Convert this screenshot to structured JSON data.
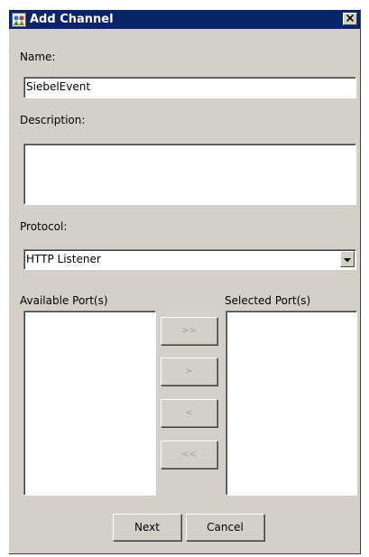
{
  "dialog": {
    "title": "Add Channel",
    "close_label": "✕"
  },
  "name": {
    "label": "Name:",
    "value": "SiebelEvent"
  },
  "description": {
    "label": "Description:",
    "value": ""
  },
  "protocol": {
    "label": "Protocol:",
    "selected": "HTTP Listener"
  },
  "ports": {
    "available_label": "Available Port(s)",
    "selected_label": "Selected Port(s)",
    "available_items": [],
    "selected_items": [],
    "move_all_right": ">>",
    "move_right": ">",
    "move_left": "<",
    "move_all_left": "<<"
  },
  "buttons": {
    "next": "Next",
    "cancel": "Cancel"
  },
  "icons": {
    "app": "channel-app-icon",
    "close": "close-icon",
    "dropdown": "chevron-down-icon"
  }
}
